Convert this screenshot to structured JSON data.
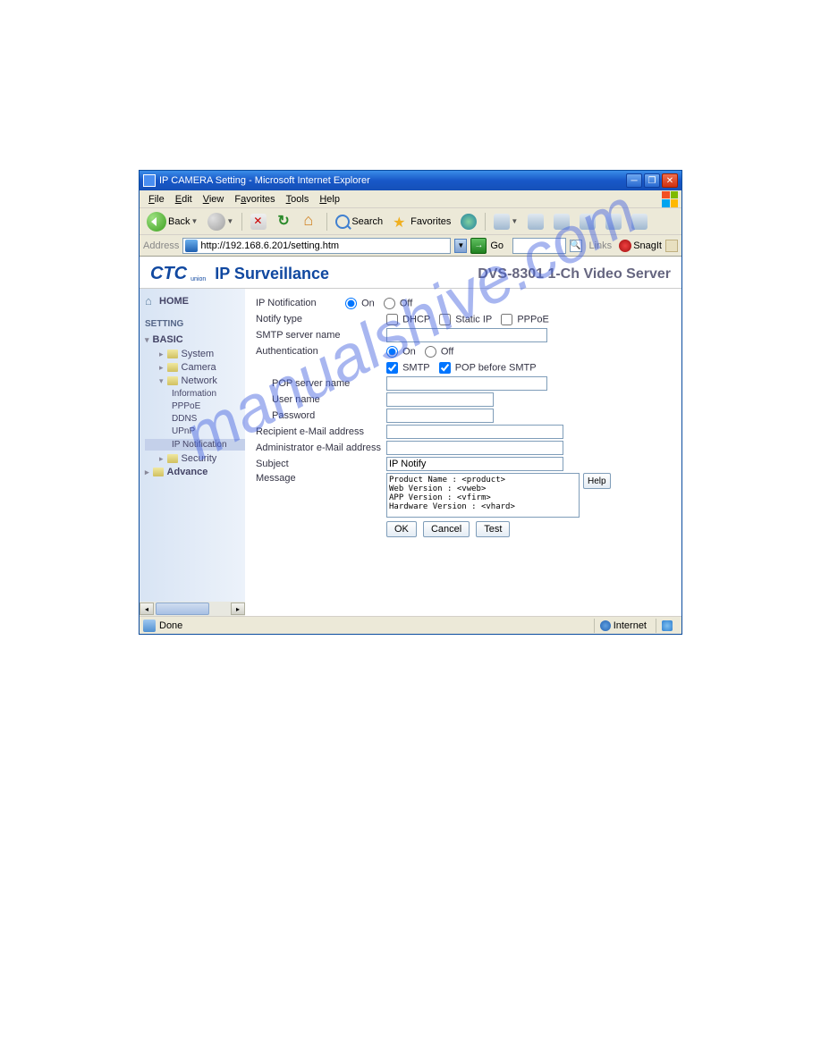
{
  "window": {
    "title": "IP CAMERA Setting - Microsoft Internet Explorer"
  },
  "menu": {
    "file": "File",
    "edit": "Edit",
    "view": "View",
    "favorites": "Favorites",
    "tools": "Tools",
    "help": "Help"
  },
  "toolbar": {
    "back": "Back",
    "search": "Search",
    "favorites": "Favorites"
  },
  "address": {
    "label": "Address",
    "url": "http://192.168.6.201/setting.htm",
    "go": "Go",
    "links": "Links",
    "snagit": "SnagIt"
  },
  "page": {
    "logo_main": "CTC",
    "logo_sub": "union",
    "logo_title": "IP Surveillance",
    "product": "DVS-8301 1-Ch Video Server"
  },
  "sidebar": {
    "home": "HOME",
    "setting": "SETTING",
    "basic": "BASIC",
    "system": "System",
    "camera": "Camera",
    "network": "Network",
    "information": "Information",
    "pppoe": "PPPoE",
    "ddns": "DDNS",
    "upnp": "UPnP",
    "ipnotification": "IP Notification",
    "security": "Security",
    "advance": "Advance"
  },
  "form": {
    "ip_notification": "IP Notification",
    "on": "On",
    "off": "Off",
    "notify_type": "Notify type",
    "dhcp": "DHCP",
    "static_ip": "Static IP",
    "pppoe": "PPPoE",
    "smtp_server": "SMTP server name",
    "authentication": "Authentication",
    "smtp": "SMTP",
    "pop_before_smtp": "POP before SMTP",
    "pop_server": "POP server name",
    "user_name": "User name",
    "password": "Password",
    "recipient": "Recipient e-Mail address",
    "admin_email": "Administrator e-Mail address",
    "subject": "Subject",
    "subject_value": "IP Notify",
    "message": "Message",
    "message_value": "Product Name : <product>\nWeb Version : <vweb>\nAPP Version : <vfirm>\nHardware Version : <vhard>",
    "ok": "OK",
    "cancel": "Cancel",
    "test": "Test",
    "help": "Help"
  },
  "status": {
    "done": "Done",
    "zone": "Internet"
  },
  "watermark": "manualshive.com"
}
